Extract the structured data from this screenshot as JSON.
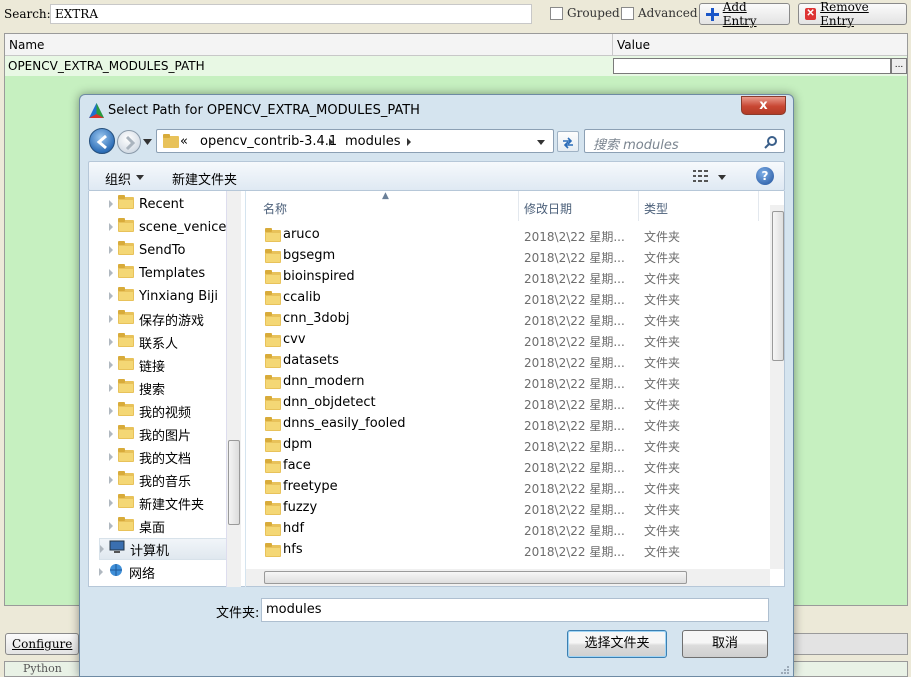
{
  "cmake": {
    "search_label": "Search:",
    "search_value": "EXTRA",
    "grouped_label": "Grouped",
    "advanced_label": "Advanced",
    "add_entry_label": "Add Entry",
    "remove_entry_label": "Remove Entry",
    "columns": [
      "Name",
      "Value"
    ],
    "entry_name": "OPENCV_EXTRA_MODULES_PATH",
    "browse_label": "...",
    "configure_label": "Configure",
    "output_text": "Python"
  },
  "dialog": {
    "title": "Select Path for OPENCV_EXTRA_MODULES_PATH",
    "close_label": "x",
    "address": {
      "overflow": "«",
      "crumbs": [
        "opencv_contrib-3.4.1",
        "modules"
      ]
    },
    "search_placeholder": "搜索 modules",
    "toolbar": {
      "organize": "组织",
      "new_folder": "新建文件夹",
      "help": "?"
    },
    "nav_items": [
      {
        "label": "Recent",
        "icon": "recent-folder-icon"
      },
      {
        "label": "scene_venice2",
        "icon": "folder-icon"
      },
      {
        "label": "SendTo",
        "icon": "sendto-folder-icon"
      },
      {
        "label": "Templates",
        "icon": "templates-folder-icon"
      },
      {
        "label": "Yinxiang Biji",
        "icon": "folder-icon"
      },
      {
        "label": "保存的游戏",
        "icon": "saved-games-icon"
      },
      {
        "label": "联系人",
        "icon": "contacts-icon"
      },
      {
        "label": "链接",
        "icon": "links-icon"
      },
      {
        "label": "搜索",
        "icon": "searches-icon"
      },
      {
        "label": "我的视频",
        "icon": "videos-icon"
      },
      {
        "label": "我的图片",
        "icon": "pictures-icon"
      },
      {
        "label": "我的文档",
        "icon": "documents-icon"
      },
      {
        "label": "我的音乐",
        "icon": "music-icon"
      },
      {
        "label": "新建文件夹",
        "icon": "folder-icon"
      },
      {
        "label": "桌面",
        "icon": "desktop-folder-icon"
      },
      {
        "label": "计算机",
        "icon": "computer-icon"
      },
      {
        "label": "网络",
        "icon": "network-icon"
      }
    ],
    "columns": {
      "name": "名称",
      "date": "修改日期",
      "type": "类型"
    },
    "files": [
      {
        "name": "aruco",
        "date": "2018\\2\\22 星期...",
        "type": "文件夹"
      },
      {
        "name": "bgsegm",
        "date": "2018\\2\\22 星期...",
        "type": "文件夹"
      },
      {
        "name": "bioinspired",
        "date": "2018\\2\\22 星期...",
        "type": "文件夹"
      },
      {
        "name": "ccalib",
        "date": "2018\\2\\22 星期...",
        "type": "文件夹"
      },
      {
        "name": "cnn_3dobj",
        "date": "2018\\2\\22 星期...",
        "type": "文件夹"
      },
      {
        "name": "cvv",
        "date": "2018\\2\\22 星期...",
        "type": "文件夹"
      },
      {
        "name": "datasets",
        "date": "2018\\2\\22 星期...",
        "type": "文件夹"
      },
      {
        "name": "dnn_modern",
        "date": "2018\\2\\22 星期...",
        "type": "文件夹"
      },
      {
        "name": "dnn_objdetect",
        "date": "2018\\2\\22 星期...",
        "type": "文件夹"
      },
      {
        "name": "dnns_easily_fooled",
        "date": "2018\\2\\22 星期...",
        "type": "文件夹"
      },
      {
        "name": "dpm",
        "date": "2018\\2\\22 星期...",
        "type": "文件夹"
      },
      {
        "name": "face",
        "date": "2018\\2\\22 星期...",
        "type": "文件夹"
      },
      {
        "name": "freetype",
        "date": "2018\\2\\22 星期...",
        "type": "文件夹"
      },
      {
        "name": "fuzzy",
        "date": "2018\\2\\22 星期...",
        "type": "文件夹"
      },
      {
        "name": "hdf",
        "date": "2018\\2\\22 星期...",
        "type": "文件夹"
      },
      {
        "name": "hfs",
        "date": "2018\\2\\22 星期...",
        "type": "文件夹"
      }
    ],
    "folder_label": "文件夹:",
    "folder_value": "modules",
    "select_button": "选择文件夹",
    "cancel_button": "取消"
  }
}
